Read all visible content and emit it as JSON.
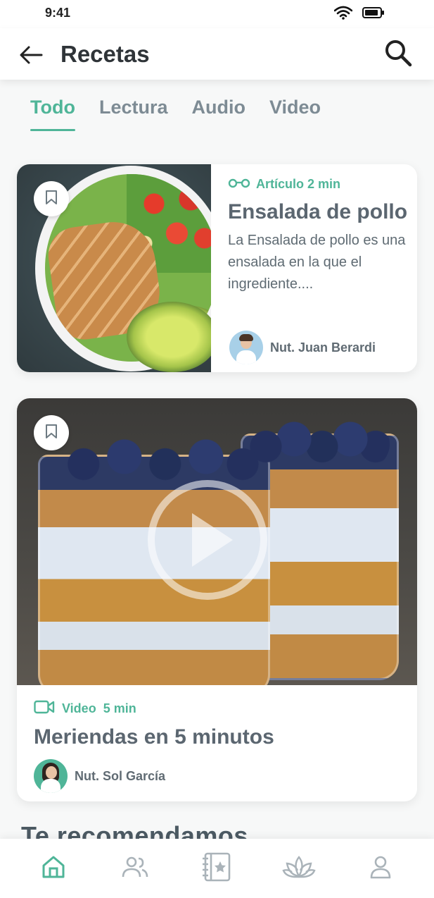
{
  "status_bar": {
    "time": "9:41"
  },
  "header": {
    "title": "Recetas"
  },
  "tabs": [
    {
      "label": "Todo",
      "active": true
    },
    {
      "label": "Lectura",
      "active": false
    },
    {
      "label": "Audio",
      "active": false
    },
    {
      "label": "Video",
      "active": false
    }
  ],
  "cards": [
    {
      "type": "Artículo",
      "duration": "2 min",
      "meta": "Artículo 2 min",
      "title": "Ensalada de pollo",
      "description": "La Ensalada de pollo es una ensalada en la que el ingrediente....",
      "author": "Nut. Juan Berardi"
    },
    {
      "type": "Video",
      "duration": "5 min",
      "title": "Meriendas en 5 minutos",
      "author": "Nut. Sol García"
    }
  ],
  "section": {
    "title": "Te recomendamos"
  },
  "bottom_nav": [
    "home-icon",
    "users-icon",
    "recipe-book-icon",
    "lotus-icon",
    "profile-icon"
  ],
  "colors": {
    "accent": "#4fb598",
    "text": "#5b6670",
    "inactive": "#9aa4aa"
  }
}
